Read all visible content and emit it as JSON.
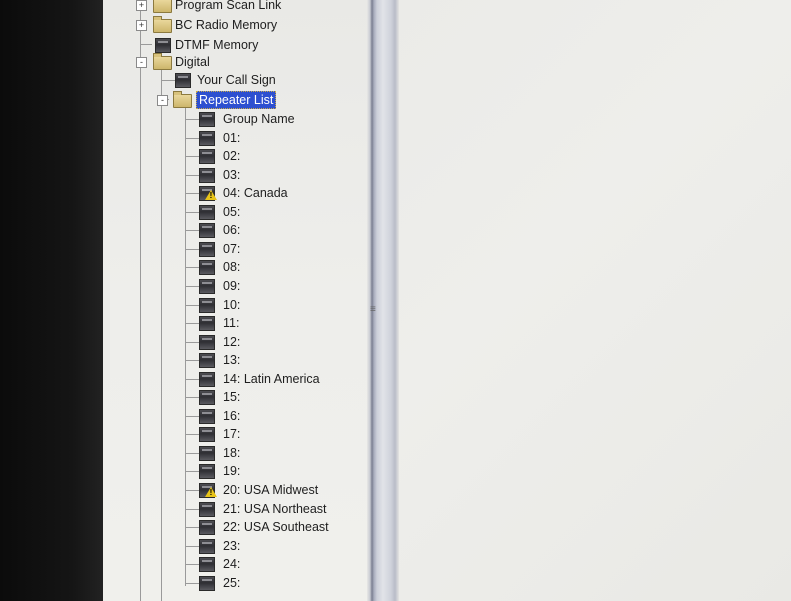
{
  "tree": {
    "top_items": [
      {
        "label": "Program Scan Link",
        "expander": "+"
      },
      {
        "label": "BC Radio Memory",
        "expander": "+"
      },
      {
        "label": "DTMF Memory"
      }
    ],
    "digital": {
      "label": "Digital",
      "expander": "-"
    },
    "your_call_sign": {
      "label": "Your Call Sign"
    },
    "repeater_list": {
      "label": "Repeater List",
      "expander": "-",
      "selected": true
    },
    "children": [
      {
        "label": "Group Name",
        "icon": "memory-icon"
      },
      {
        "label": "01:",
        "icon": "memory-icon"
      },
      {
        "label": "02:",
        "icon": "memory-icon"
      },
      {
        "label": "03:",
        "icon": "memory-icon"
      },
      {
        "label": "04: Canada",
        "icon": "warning-icon"
      },
      {
        "label": "05:",
        "icon": "memory-icon"
      },
      {
        "label": "06:",
        "icon": "memory-icon"
      },
      {
        "label": "07:",
        "icon": "memory-icon"
      },
      {
        "label": "08:",
        "icon": "memory-icon"
      },
      {
        "label": "09:",
        "icon": "memory-icon"
      },
      {
        "label": "10:",
        "icon": "memory-icon"
      },
      {
        "label": "11:",
        "icon": "memory-icon"
      },
      {
        "label": "12:",
        "icon": "memory-icon"
      },
      {
        "label": "13:",
        "icon": "memory-icon"
      },
      {
        "label": "14: Latin America",
        "icon": "memory-icon"
      },
      {
        "label": "15:",
        "icon": "memory-icon"
      },
      {
        "label": "16:",
        "icon": "memory-icon"
      },
      {
        "label": "17:",
        "icon": "memory-icon"
      },
      {
        "label": "18:",
        "icon": "memory-icon"
      },
      {
        "label": "19:",
        "icon": "memory-icon"
      },
      {
        "label": "20: USA Midwest",
        "icon": "warning-icon"
      },
      {
        "label": "21: USA Northeast",
        "icon": "memory-icon"
      },
      {
        "label": "22: USA Southeast",
        "icon": "memory-icon"
      },
      {
        "label": "23:",
        "icon": "memory-icon"
      },
      {
        "label": "24:",
        "icon": "memory-icon"
      },
      {
        "label": "25:",
        "icon": "memory-icon"
      }
    ]
  },
  "splitter": {
    "grip": "≡"
  },
  "colors": {
    "selection": "#2d4fd0",
    "warning": "#e8c418"
  }
}
